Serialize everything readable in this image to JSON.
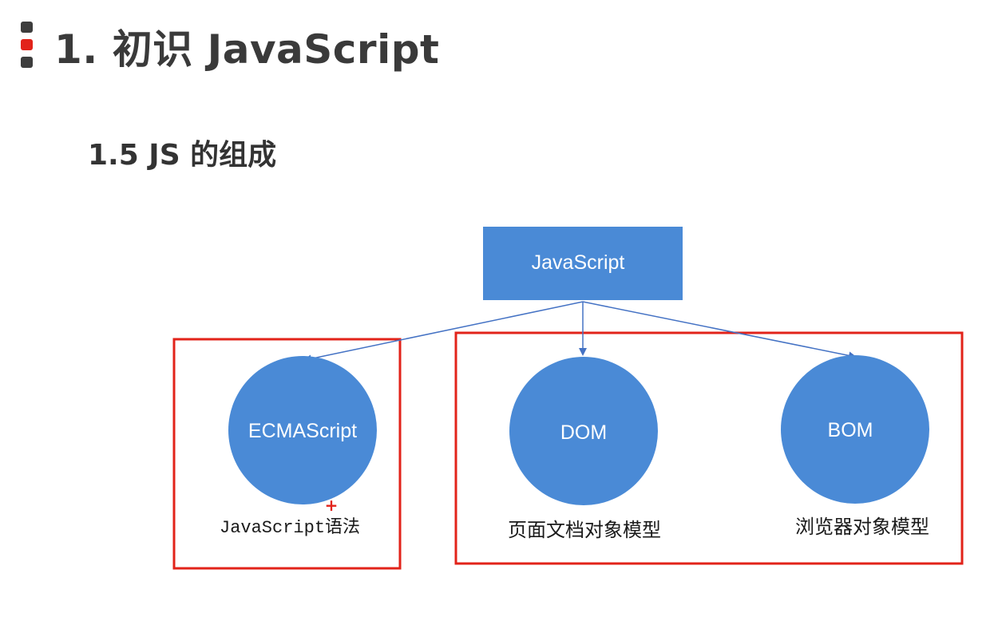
{
  "header": {
    "title": "1. 初识 JavaScript",
    "marker_colors": [
      "#3d3d3d",
      "#e2231a",
      "#3d3d3d"
    ]
  },
  "section": {
    "title": "1.5 JS 的组成"
  },
  "diagram": {
    "root": {
      "label": "JavaScript"
    },
    "nodes": [
      {
        "label": "ECMAScript",
        "caption_code": "JavaScript",
        "caption_text": "语法"
      },
      {
        "label": "DOM",
        "caption": "页面文档对象模型"
      },
      {
        "label": "BOM",
        "caption": "浏览器对象模型"
      }
    ],
    "cursor_glyph": "+",
    "colors": {
      "node_fill": "#4a8ad6",
      "edge": "#4472c4",
      "group_outline": "#e2231a"
    }
  }
}
